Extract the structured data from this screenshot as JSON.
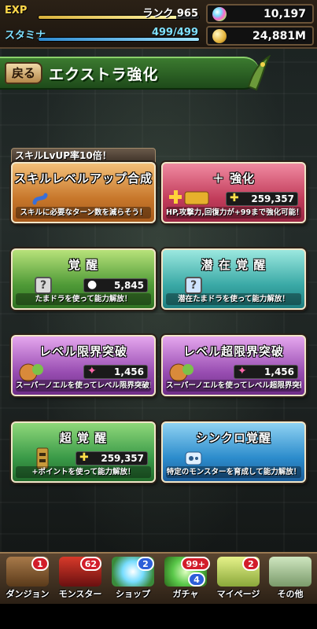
{
  "status": {
    "exp_label": "EXP",
    "exp_fraction": 0.86,
    "rank_text": "ランク 965",
    "stamina_label": "スタミナ",
    "stamina_fraction": 1.0,
    "stamina_value": "499/499",
    "magic_stones": "10,197",
    "coins": "24,881M"
  },
  "header": {
    "back_label": "戻る",
    "title": "エクストラ強化"
  },
  "banner": "スキルLvUP率10倍！",
  "cards": {
    "skill_up": {
      "title": "スキルレベルアップ合成",
      "desc": "スキルに必要なターン数を減らそう！"
    },
    "plus": {
      "title": "＋ 強化",
      "value": "259,357",
      "desc": "HP,攻撃力,回復力が+99まで強化可能！"
    },
    "awaken": {
      "title": "覚 醒",
      "value": "5,845",
      "desc": "たまドラを使って能力解放！"
    },
    "latent": {
      "title": "潜 在 覚 醒",
      "desc": "潜在たまドラを使って能力解放！"
    },
    "limit_break": {
      "title": "レベル限界突破",
      "value": "1,456",
      "desc": "スーパーノエルを使ってレベル限界突破！"
    },
    "super_limit_break": {
      "title": "レベル超限界突破",
      "value": "1,456",
      "desc": "スーパーノエルを使ってレベル超限界突破！"
    },
    "super_awaken": {
      "title": "超 覚 醒",
      "value": "259,357",
      "desc": "+ポイントを使って能力解放！"
    },
    "synchro": {
      "title": "シンクロ覚醒",
      "desc": "特定のモンスターを育成して能力解放！"
    }
  },
  "nav": [
    {
      "label": "ダンジョン",
      "badge": "1",
      "badge_color": "#d21d2a"
    },
    {
      "label": "モンスター",
      "badge": "62",
      "badge_color": "#d21d2a"
    },
    {
      "label": "ショップ",
      "badge": "2",
      "badge_color": "#2d5fd8"
    },
    {
      "label": "ガチャ",
      "badge": "99+",
      "badge2": "4",
      "badge_color": "#d21d2a"
    },
    {
      "label": "マイページ",
      "badge": "2",
      "badge_color": "#d21d2a"
    },
    {
      "label": "その他"
    }
  ]
}
